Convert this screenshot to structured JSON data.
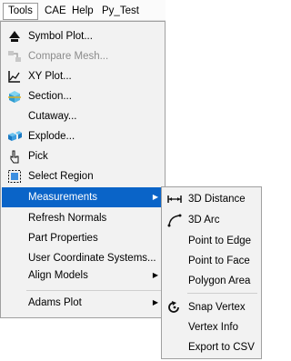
{
  "menubar": {
    "items": [
      "Tools",
      "CAE",
      "Help",
      "Py_Test"
    ]
  },
  "tools_menu": {
    "items": [
      {
        "label": "Symbol Plot...",
        "icon": "symbol-plot-icon"
      },
      {
        "label": "Compare Mesh...",
        "icon": "compare-mesh-icon",
        "disabled": true
      },
      {
        "label": "XY Plot...",
        "icon": "xy-plot-icon"
      },
      {
        "label": "Section...",
        "icon": "section-icon"
      },
      {
        "label": "Cutaway..."
      },
      {
        "label": "Explode...",
        "icon": "explode-icon"
      },
      {
        "label": "Pick",
        "icon": "pick-icon"
      },
      {
        "label": "Select Region",
        "icon": "select-region-icon"
      },
      {
        "label": "Measurements",
        "submenu": true,
        "highlighted": true
      },
      {
        "label": "Refresh Normals"
      },
      {
        "label": "Part Properties"
      },
      {
        "label": "User Coordinate Systems..."
      },
      {
        "label": "Align Models",
        "submenu": true
      },
      {
        "label": "Adams Plot",
        "submenu": true
      }
    ]
  },
  "measurements_menu": {
    "items": [
      {
        "label": "3D Distance",
        "icon": "distance-icon"
      },
      {
        "label": "3D Arc",
        "icon": "arc-icon"
      },
      {
        "label": "Point to Edge"
      },
      {
        "label": "Point to Face"
      },
      {
        "label": "Polygon Area"
      },
      {
        "label": "Snap Vertex",
        "icon": "snap-vertex-icon"
      },
      {
        "label": "Vertex Info"
      },
      {
        "label": "Export to CSV"
      }
    ]
  },
  "colors": {
    "highlight": "#0a64c8",
    "menu_background": "#f2f2f2",
    "disabled_text": "#8c8c8c"
  }
}
